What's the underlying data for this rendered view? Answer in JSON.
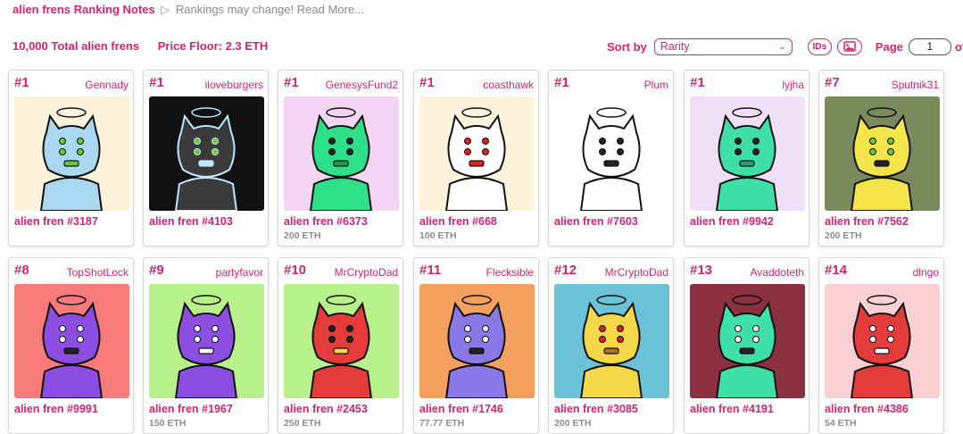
{
  "top": {
    "title": "alien frens Ranking Notes",
    "triangle": "▷",
    "note": "Rankings may change! Read More..."
  },
  "stats": {
    "total": "10,000 Total alien frens",
    "floor": "Price Floor: 2.3 ETH"
  },
  "controls": {
    "sort_label": "Sort by",
    "sort_value": "Rarity",
    "ids_label": "IDs",
    "page_label": "Page",
    "page_value": "1",
    "of_label": "of"
  },
  "cards": [
    {
      "rank": "#1",
      "owner": "Gennady",
      "name": "alien fren #3187",
      "price": "",
      "bg": "#fdf3dc",
      "body": "#a9d8f0",
      "accent": "#6fc832",
      "dark": false,
      "eye": "#6fc832"
    },
    {
      "rank": "#1",
      "owner": "iloveburgers",
      "name": "alien fren #4103",
      "price": "",
      "bg": "#111111",
      "body": "#3a3a3a",
      "accent": "#bfe8ff",
      "dark": true,
      "eye": "#6fc832"
    },
    {
      "rank": "#1",
      "owner": "GenesysFund2",
      "name": "alien fren #6373",
      "price": "200 ETH",
      "bg": "#f2d6f3",
      "body": "#2fe08a",
      "accent": "#1f9a5a",
      "dark": false,
      "eye": "#222222"
    },
    {
      "rank": "#1",
      "owner": "coasthawk",
      "name": "alien fren #668",
      "price": "100 ETH",
      "bg": "#fdf3dc",
      "body": "#ffffff",
      "accent": "#e02020",
      "dark": false,
      "eye": "#e02020"
    },
    {
      "rank": "#1",
      "owner": "Plum",
      "name": "alien fren #7603",
      "price": "",
      "bg": "#ffffff",
      "body": "#ffffff",
      "accent": "#222222",
      "dark": false,
      "eye": "#222222"
    },
    {
      "rank": "#1",
      "owner": "lyjha",
      "name": "alien fren #9942",
      "price": "",
      "bg": "#efdff7",
      "body": "#3fe0a7",
      "accent": "#2a9a70",
      "dark": false,
      "eye": "#222222"
    },
    {
      "rank": "#7",
      "owner": "Sputnik31",
      "name": "alien fren #7562",
      "price": "200 ETH",
      "bg": "#7a8a5c",
      "body": "#f4e64a",
      "accent": "#222222",
      "dark": false,
      "eye": "#6fc832"
    },
    {
      "rank": "#8",
      "owner": "TopShotLock",
      "name": "alien fren #9991",
      "price": "",
      "bg": "#f87b7b",
      "body": "#8c4ee0",
      "accent": "#222222",
      "dark": false,
      "eye": "#ffffff"
    },
    {
      "rank": "#9",
      "owner": "partyfavor",
      "name": "alien fren #1967",
      "price": "150 ETH",
      "bg": "#b8f08c",
      "body": "#8c4ee0",
      "accent": "#ffffff",
      "dark": false,
      "eye": "#ffffff"
    },
    {
      "rank": "#10",
      "owner": "MrCryptoDad",
      "name": "alien fren #2453",
      "price": "250 ETH",
      "bg": "#b8f08c",
      "body": "#e43b3b",
      "accent": "#f6d24a",
      "dark": false,
      "eye": "#222222"
    },
    {
      "rank": "#11",
      "owner": "Flecksible",
      "name": "alien fren #1746",
      "price": "77.77 ETH",
      "bg": "#f6a060",
      "body": "#8a78e6",
      "accent": "#222222",
      "dark": false,
      "eye": "#ffffff"
    },
    {
      "rank": "#12",
      "owner": "MrCryptoDad",
      "name": "alien fren #3085",
      "price": "200 ETH",
      "bg": "#6cc2d6",
      "body": "#f4d84a",
      "accent": "#b0731f",
      "dark": false,
      "eye": "#e02020"
    },
    {
      "rank": "#13",
      "owner": "Avaddoteth",
      "name": "alien fren #4191",
      "price": "",
      "bg": "#8a3040",
      "body": "#3fe0a7",
      "accent": "#222222",
      "dark": false,
      "eye": "#ffffff"
    },
    {
      "rank": "#14",
      "owner": "dlngo",
      "name": "alien fren #4386",
      "price": "54 ETH",
      "bg": "#fbd0d2",
      "body": "#e43b3b",
      "accent": "#ffffff",
      "dark": false,
      "eye": "#ffffff"
    }
  ]
}
